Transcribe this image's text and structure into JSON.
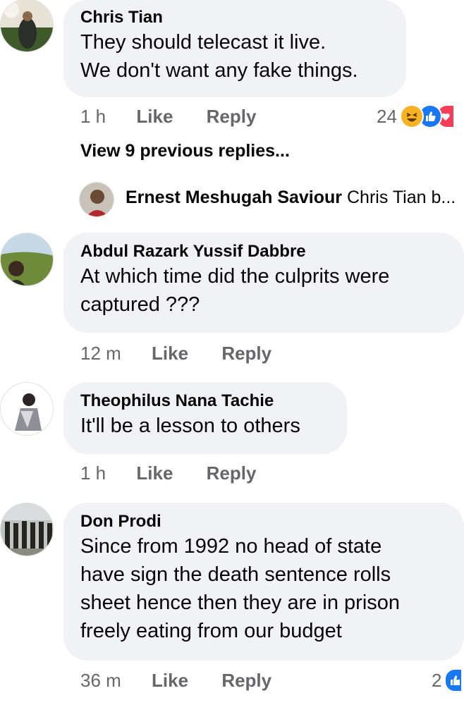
{
  "comments": [
    {
      "author": "Chris Tian",
      "lines": [
        "They should telecast it live.",
        "We don't want any fake things."
      ],
      "time": "1 h",
      "like": "Like",
      "reply": "Reply",
      "reaction_count": "24",
      "reactions": [
        "haha-icon",
        "like-icon",
        "love-icon"
      ]
    },
    {
      "author": "Abdul Razark Yussif Dabbre",
      "lines": [
        "At which time did the culprits were",
        "captured ???"
      ],
      "time": "12 m",
      "like": "Like",
      "reply": "Reply"
    },
    {
      "author": "Theophilus Nana Tachie",
      "lines": [
        "It'll be a lesson to others"
      ],
      "time": "1 h",
      "like": "Like",
      "reply": "Reply"
    },
    {
      "author": "Don Prodi",
      "lines": [
        "Since from 1992 no head of state",
        "have sign the death sentence rolls",
        "sheet hence then they are in prison",
        "freely eating from our budget"
      ],
      "time": "36 m",
      "like": "Like",
      "reply": "Reply",
      "reaction_count": "2",
      "reactions": [
        "like-icon"
      ]
    }
  ],
  "view_previous": "View 9 previous replies...",
  "reply_preview": {
    "author": "Ernest Meshugah Saviour",
    "text": "Chris Tian b..."
  },
  "colors": {
    "bubble": "#f0f2f5",
    "meta": "#65676b",
    "like_blue": "#1877f2",
    "love_red": "#f33e58",
    "haha_yellow": "#f7b125"
  }
}
